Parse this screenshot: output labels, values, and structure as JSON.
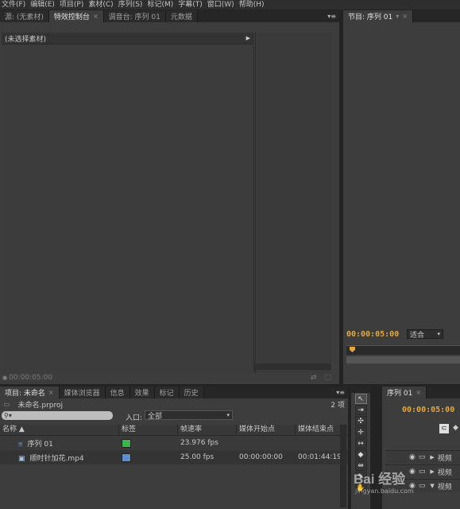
{
  "menu": [
    "文件(F)",
    "编辑(E)",
    "项目(P)",
    "素材(C)",
    "序列(S)",
    "标记(M)",
    "字幕(T)",
    "窗口(W)",
    "帮助(H)"
  ],
  "source_panel": {
    "tabs": [
      "源: (无素材)",
      "特效控制台",
      "调音台: 序列 01",
      "元数据"
    ],
    "no_clip_label": "(未选择素材)",
    "timecode": "00:00:05:00"
  },
  "program_monitor": {
    "tab": "节目: 序列 01",
    "timecode": "00:00:05:00",
    "fit_label": "适合"
  },
  "project_panel": {
    "tabs": [
      "项目: 未命名",
      "媒体浏览器",
      "信息",
      "效果",
      "标记",
      "历史"
    ],
    "filename": "未命名.prproj",
    "item_count": "2 项",
    "in_label": "入口:",
    "in_value": "全部",
    "columns": [
      "名称",
      "标签",
      "帧速率",
      "媒体开始点",
      "媒体结束点"
    ],
    "rows": [
      {
        "name": "序列 01",
        "label_color": "#3cb44b",
        "fps": "23.976 fps",
        "start": "",
        "end": ""
      },
      {
        "name": "顺时针加花.mp4",
        "label_color": "#5b8fd0",
        "fps": "25.00 fps",
        "start": "00:00:00:00",
        "end": "00:01:44:19"
      }
    ]
  },
  "timeline_panel": {
    "tab": "序列 01",
    "timecode": "00:00:05:00",
    "tracks": [
      "视频",
      "视频",
      "视频"
    ]
  },
  "watermark": "Bai 经验",
  "watermark_url": "jingyan.baidu.com"
}
